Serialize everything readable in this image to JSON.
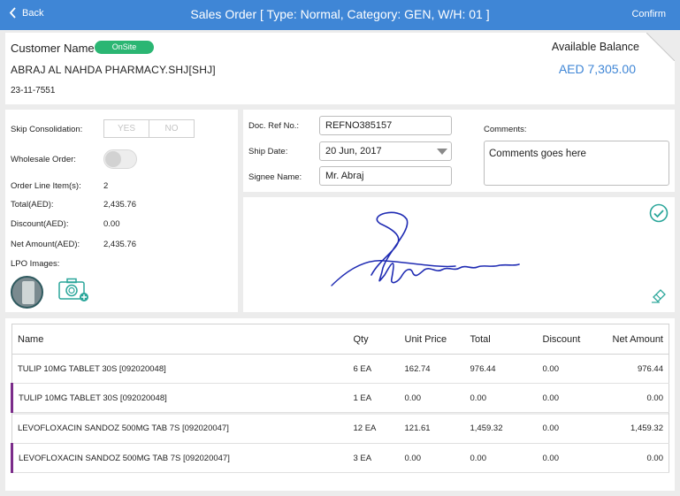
{
  "header": {
    "back_label": "Back",
    "title": "Sales Order [ Type: Normal, Category: GEN, W/H: 01 ]",
    "confirm_label": "Confirm"
  },
  "customer": {
    "name_label": "Customer Name",
    "badge": "OnSite",
    "name": "ABRAJ AL NAHDA PHARMACY.SHJ[SHJ]",
    "date": "23-11-7551",
    "balance_label": "Available Balance",
    "balance_value": "AED 7,305.00"
  },
  "summary": {
    "skip_label": "Skip Consolidation:",
    "yes": "YES",
    "no": "NO",
    "wholesale_label": "Wholesale Order:",
    "line_items_label": "Order Line Item(s):",
    "line_items_value": "2",
    "total_label": "Total(AED):",
    "total_value": "2,435.76",
    "discount_label": "Discount(AED):",
    "discount_value": "0.00",
    "net_label": "Net Amount(AED):",
    "net_value": "2,435.76",
    "lpo_label": "LPO Images:"
  },
  "doc": {
    "ref_label": "Doc. Ref No.:",
    "ref_value": "REFNO385157",
    "ship_label": "Ship Date:",
    "ship_value": "20 Jun, 2017",
    "signee_label": "Signee Name:",
    "signee_value": "Mr. Abraj",
    "comments_label": "Comments:",
    "comments_value": "Comments goes here"
  },
  "table": {
    "headers": [
      "Name",
      "Qty",
      "Unit Price",
      "Total",
      "Discount",
      "Net Amount"
    ],
    "rows": [
      {
        "name": "TULIP 10MG TABLET 30S [092020048]",
        "qty": "6 EA",
        "unit": "162.74",
        "total": "976.44",
        "discount": "0.00",
        "net": "976.44"
      },
      {
        "name": "TULIP 10MG TABLET 30S [092020048]",
        "qty": "1 EA",
        "unit": "0.00",
        "total": "0.00",
        "discount": "0.00",
        "net": "0.00"
      },
      {
        "name": "LEVOFLOXACIN SANDOZ 500MG TAB 7S [092020047]",
        "qty": "12 EA",
        "unit": "121.61",
        "total": "1,459.32",
        "discount": "0.00",
        "net": "1,459.32"
      },
      {
        "name": "LEVOFLOXACIN SANDOZ 500MG TAB 7S [092020047]",
        "qty": "3 EA",
        "unit": "0.00",
        "total": "0.00",
        "discount": "0.00",
        "net": "0.00"
      }
    ]
  },
  "colors": {
    "header_blue": "#3f86d6",
    "badge_green": "#2bb673",
    "accent_teal": "#2aa69a",
    "child_row_bar": "#7b2c8a",
    "signature_ink": "#1f2bb3"
  }
}
